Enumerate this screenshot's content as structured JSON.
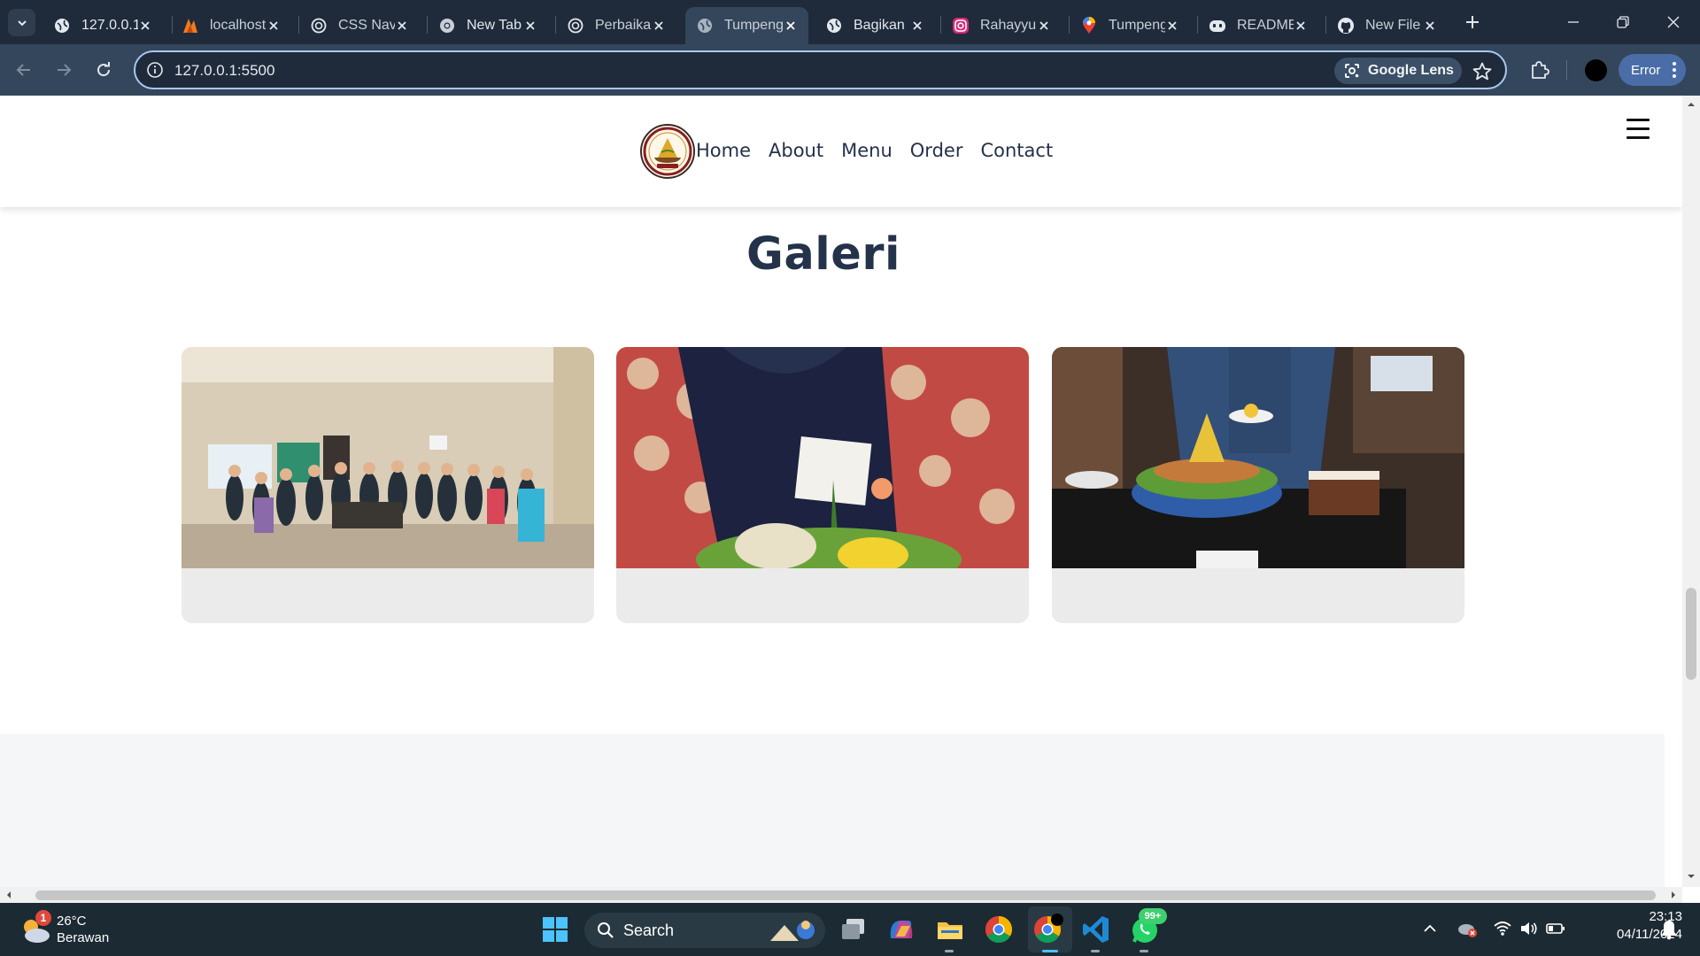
{
  "browser": {
    "tabs": [
      {
        "title": "127.0.0.1",
        "favicon": "globe-icon",
        "active": false
      },
      {
        "title": "localhost",
        "favicon": "xampp-icon",
        "active": false
      },
      {
        "title": "CSS Nav",
        "favicon": "chatgpt-icon",
        "active": false
      },
      {
        "title": "New Tab",
        "favicon": "chrome-icon",
        "active": false
      },
      {
        "title": "Perbaika",
        "favicon": "chatgpt-icon",
        "active": false
      },
      {
        "title": "Tumpeng",
        "favicon": "globe-icon",
        "active": true
      },
      {
        "title": "Bagikan",
        "favicon": "globe-icon",
        "active": false
      },
      {
        "title": "Rahayyu",
        "favicon": "instagram-icon",
        "active": false
      },
      {
        "title": "Tumpeng",
        "favicon": "maps-icon",
        "active": false
      },
      {
        "title": "README",
        "favicon": "copilot-icon",
        "active": false
      },
      {
        "title": "New File",
        "favicon": "github-icon",
        "active": false
      }
    ],
    "url": "127.0.0.1:5500",
    "lens_label": "Google Lens",
    "error_label": "Error"
  },
  "site": {
    "nav": [
      "Home",
      "About",
      "Menu",
      "Order",
      "Contact"
    ],
    "section_title": "Galeri",
    "gallery": [
      {
        "photo": "group-photo-office"
      },
      {
        "photo": "tumpeng-birthday-card"
      },
      {
        "photo": "tumpeng-serving-table"
      }
    ],
    "colors": {
      "heading": "#24324a",
      "card_bg": "#ebebeb"
    }
  },
  "taskbar": {
    "weather_temp": "26°C",
    "weather_cond": "Berawan",
    "weather_badge": "1",
    "search_label": "Search",
    "whatsapp_badge": "99+",
    "time": "23:13",
    "date": "04/11/2024"
  }
}
